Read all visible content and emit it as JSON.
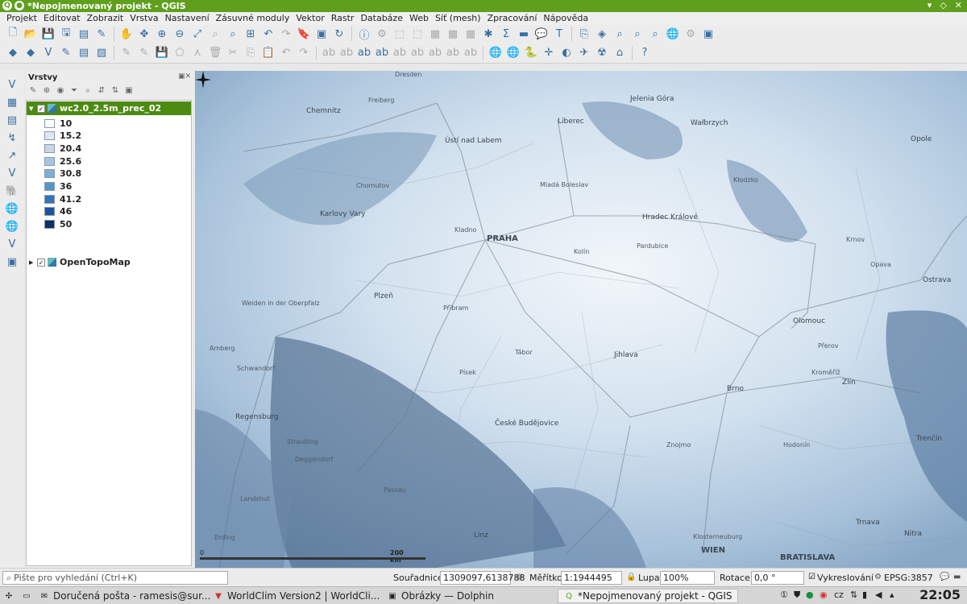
{
  "window": {
    "title": "*Nepojmenovaný projekt - QGIS"
  },
  "menu": [
    "Projekt",
    "Editovat",
    "Zobrazit",
    "Vrstva",
    "Nastavení",
    "Zásuvné moduly",
    "Vektor",
    "Rastr",
    "Databáze",
    "Web",
    "Síť (mesh)",
    "Zpracování",
    "Nápověda"
  ],
  "layers_panel": {
    "title": "Vrstvy",
    "layers": [
      {
        "name": "wc2.0_2.5m_prec_02",
        "checked": true,
        "legend": [
          {
            "label": "10",
            "color": "#ffffff"
          },
          {
            "label": "15.2",
            "color": "#dde8f4"
          },
          {
            "label": "20.4",
            "color": "#c4d8ec"
          },
          {
            "label": "25.6",
            "color": "#a4c6e2"
          },
          {
            "label": "30.8",
            "color": "#7db0d8"
          },
          {
            "label": "36",
            "color": "#5596ca"
          },
          {
            "label": "41.2",
            "color": "#3374b8"
          },
          {
            "label": "46",
            "color": "#1c52a0"
          },
          {
            "label": "50",
            "color": "#0b2e6e"
          }
        ]
      },
      {
        "name": "OpenTopoMap",
        "checked": true
      }
    ]
  },
  "map": {
    "scale_zero": "0",
    "scale_label": "200 km",
    "places": {
      "dresden": "Dresden",
      "chemnitz": "Chemnitz",
      "freiberg": "Freiberg",
      "liberec": "Liberec",
      "jelenia": "Jelenia Góra",
      "walbrzych": "Wałbrzych",
      "usti": "Ústí nad Labem",
      "karlovy": "Karlovy Vary",
      "chomutov": "Chomutov",
      "mlada": "Mladá Boleslav",
      "praha": "PRAHA",
      "hradec": "Hradec Králové",
      "pardubice": "Pardubice",
      "kladno": "Kladno",
      "kolin": "Kolín",
      "plzen": "Plzeň",
      "pribram": "Příbram",
      "tabor": "Tábor",
      "pisek": "Písek",
      "jihlava": "Jihlava",
      "olomouc": "Olomouc",
      "ostrava": "Ostrava",
      "opole": "Opole",
      "brno": "Brno",
      "zlin": "Zlín",
      "prerov": "Přerov",
      "kromeriz": "Kroměříž",
      "budejovice": "České Budějovice",
      "regensburg": "Regensburg",
      "amberg": "Amberg",
      "passau": "Passau",
      "deggendorf": "Deggendorf",
      "straubing": "Straubing",
      "landshut": "Landshut",
      "linz": "Linz",
      "wien": "WIEN",
      "bratislava": "BRATISLAVA",
      "trencin": "Trenčín",
      "nitra": "Nitra",
      "trnava": "Trnava",
      "znojmo": "Znojmo",
      "hodonin": "Hodonín",
      "klodzko": "Kłodzko",
      "krnov": "Krnov",
      "opava": "Opava",
      "klosterneuburg": "Klosterneuburg",
      "weiden": "Weiden in der Oberpfalz",
      "schwandorf": "Schwandorf",
      "erding": "Erding"
    }
  },
  "statusbar": {
    "search_placeholder": "Pište pro vyhledání (Ctrl+K)",
    "coords_label": "Souřadnice",
    "coords_value": "1309097,6138788",
    "scale_label": "Měřítko",
    "scale_value": "1:1944495",
    "magnifier_label": "Lupa",
    "magnifier_value": "100%",
    "rotation_label": "Rotace",
    "rotation_value": "0,0 °",
    "render_label": "Vykreslování",
    "crs": "EPSG:3857"
  },
  "taskbar": {
    "tasks": [
      "Doručená pošta - ramesis@sur...",
      "WorldClim Version2 | WorldCli...",
      "Obrázky — Dolphin",
      "*Nepojmenovaný projekt - QGIS"
    ],
    "keyboard": "cz",
    "clock": "22:05"
  }
}
